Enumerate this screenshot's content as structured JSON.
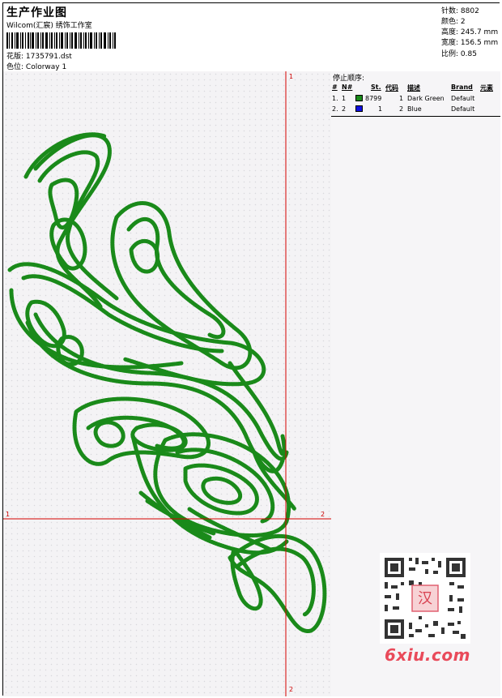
{
  "header": {
    "title": "生产作业图",
    "company": "Wilcom(汇宸) 绣饰工作室",
    "design_label": "花版:",
    "design_value": "1735791.dst",
    "colorway_label": "色位:",
    "colorway_value": "Colorway 1"
  },
  "stats": [
    {
      "label": "针数:",
      "value": "8802"
    },
    {
      "label": "颜色:",
      "value": "2"
    },
    {
      "label": "高度:",
      "value": "245.7 mm"
    },
    {
      "label": "宽度:",
      "value": "156.5 mm"
    },
    {
      "label": "比例:",
      "value": "0.85"
    }
  ],
  "crosshair": {
    "top_label": "1",
    "bottom_label": "2",
    "left_label": "1",
    "right_label": "2"
  },
  "stop_sequence": {
    "title": "停止顺序:",
    "columns": [
      "#",
      "N#",
      "St.",
      "代码",
      "描述",
      "Brand",
      "元素"
    ],
    "rows": [
      {
        "idx": "1.",
        "n": "1",
        "color": "#1a8a1a",
        "stitches": "8799",
        "code": "1",
        "desc": "Dark Green",
        "brand": "Default"
      },
      {
        "idx": "2.",
        "n": "2",
        "color": "#1010e0",
        "stitches": "1",
        "code": "2",
        "desc": "Blue",
        "brand": "Default"
      }
    ]
  },
  "watermark": {
    "seal_text": "汉",
    "brand": "6xiu.com"
  },
  "colors": {
    "stitch": "#1a8a1a",
    "crosshair": "#d40000"
  }
}
